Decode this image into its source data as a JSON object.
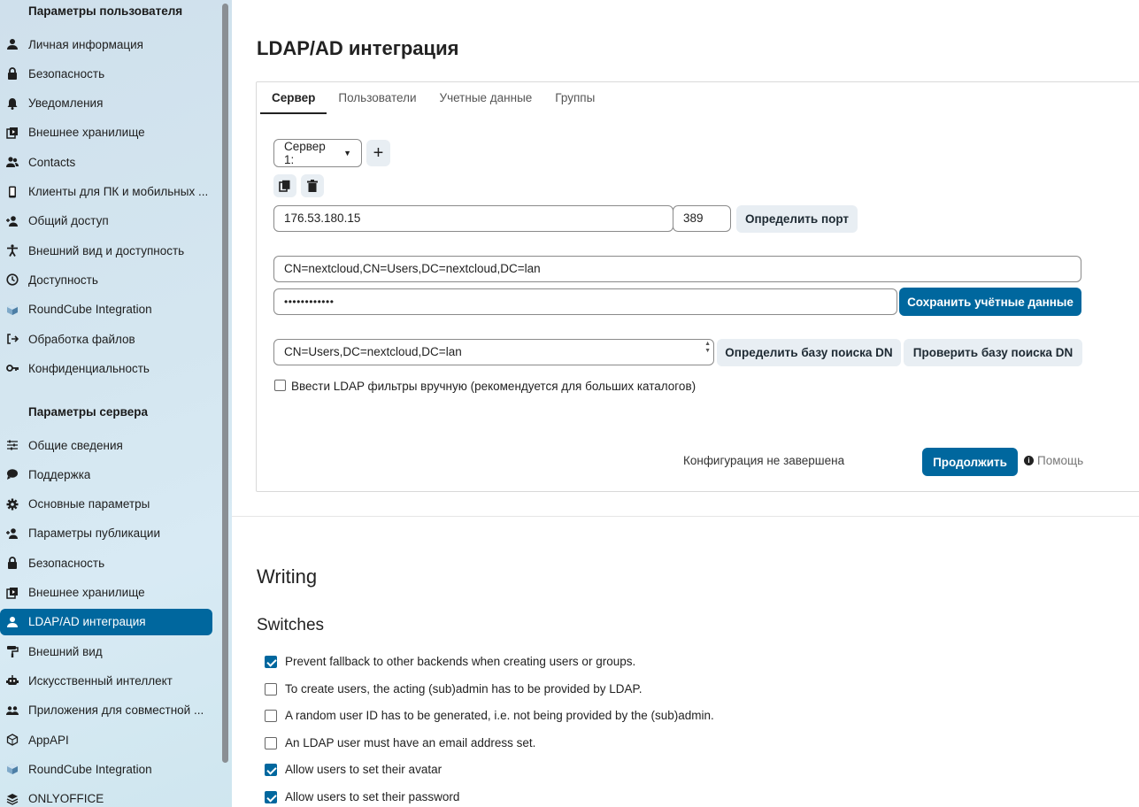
{
  "sidebar": {
    "personal_heading": "Параметры пользователя",
    "personal_items": [
      {
        "label": "Личная информация",
        "icon": "person-icon"
      },
      {
        "label": "Безопасность",
        "icon": "lock-icon"
      },
      {
        "label": "Уведомления",
        "icon": "bell-icon"
      },
      {
        "label": "Внешнее хранилище",
        "icon": "external-storage-icon"
      },
      {
        "label": "Contacts",
        "icon": "contacts-icon"
      },
      {
        "label": "Клиенты для ПК и мобильных ...",
        "icon": "phone-icon"
      },
      {
        "label": "Общий доступ",
        "icon": "share-icon"
      },
      {
        "label": "Внешний вид и доступность",
        "icon": "accessibility-icon"
      },
      {
        "label": "Доступность",
        "icon": "clock-icon"
      },
      {
        "label": "RoundCube Integration",
        "icon": "roundcube-icon"
      },
      {
        "label": "Обработка файлов",
        "icon": "file-processing-icon"
      },
      {
        "label": "Конфиденциальность",
        "icon": "key-icon"
      }
    ],
    "server_heading": "Параметры сервера",
    "server_items": [
      {
        "label": "Общие сведения",
        "icon": "tune-icon"
      },
      {
        "label": "Поддержка",
        "icon": "chat-icon"
      },
      {
        "label": "Основные параметры",
        "icon": "gear-icon"
      },
      {
        "label": "Параметры публикации",
        "icon": "share-icon"
      },
      {
        "label": "Безопасность",
        "icon": "lock-icon"
      },
      {
        "label": "Внешнее хранилище",
        "icon": "external-storage-icon"
      },
      {
        "label": "LDAP/AD интеграция",
        "icon": "person-icon",
        "active": true
      },
      {
        "label": "Внешний вид",
        "icon": "paint-roller-icon"
      },
      {
        "label": "Искусственный интеллект",
        "icon": "robot-icon"
      },
      {
        "label": "Приложения для совместной ...",
        "icon": "group-icon"
      },
      {
        "label": "AppAPI",
        "icon": "appapi-icon"
      },
      {
        "label": "RoundCube Integration",
        "icon": "roundcube-icon"
      },
      {
        "label": "ONLYOFFICE",
        "icon": "onlyoffice-icon"
      }
    ]
  },
  "main": {
    "title": "LDAP/AD интеграция",
    "tabs": [
      "Сервер",
      "Пользователи",
      "Учетные данные",
      "Группы"
    ],
    "active_tab": "Сервер",
    "server_select": "Сервер 1:",
    "host_value": "176.53.180.15",
    "port_value": "389",
    "detect_port_label": "Определить порт",
    "user_dn_value": "CN=nextcloud,CN=Users,DC=nextcloud,DC=lan",
    "password_value": "••••••••••••",
    "save_credentials_label": "Сохранить учётные данные",
    "base_dn_value": "CN=Users,DC=nextcloud,DC=lan",
    "detect_base_dn_label": "Определить базу поиска DN",
    "test_base_dn_label": "Проверить базу поиска DN",
    "manual_filter_label": "Ввести LDAP фильтры вручную (рекомендуется для больших каталогов)",
    "manual_filter_checked": false,
    "config_status": "Конфигурация не завершена",
    "continue_label": "Продолжить",
    "help_label": "Помощь"
  },
  "writing": {
    "heading": "Writing",
    "switches_heading": "Switches",
    "switches": [
      {
        "label": "Prevent fallback to other backends when creating users or groups.",
        "checked": true
      },
      {
        "label": "To create users, the acting (sub)admin has to be provided by LDAP.",
        "checked": false
      },
      {
        "label": "A random user ID has to be generated, i.e. not being provided by the (sub)admin.",
        "checked": false
      },
      {
        "label": "An LDAP user must have an email address set.",
        "checked": false
      },
      {
        "label": "Allow users to set their avatar",
        "checked": true
      },
      {
        "label": "Allow users to set their password",
        "checked": true
      }
    ]
  },
  "colors": {
    "accent": "#00679e",
    "button_light": "#e8eef3"
  }
}
